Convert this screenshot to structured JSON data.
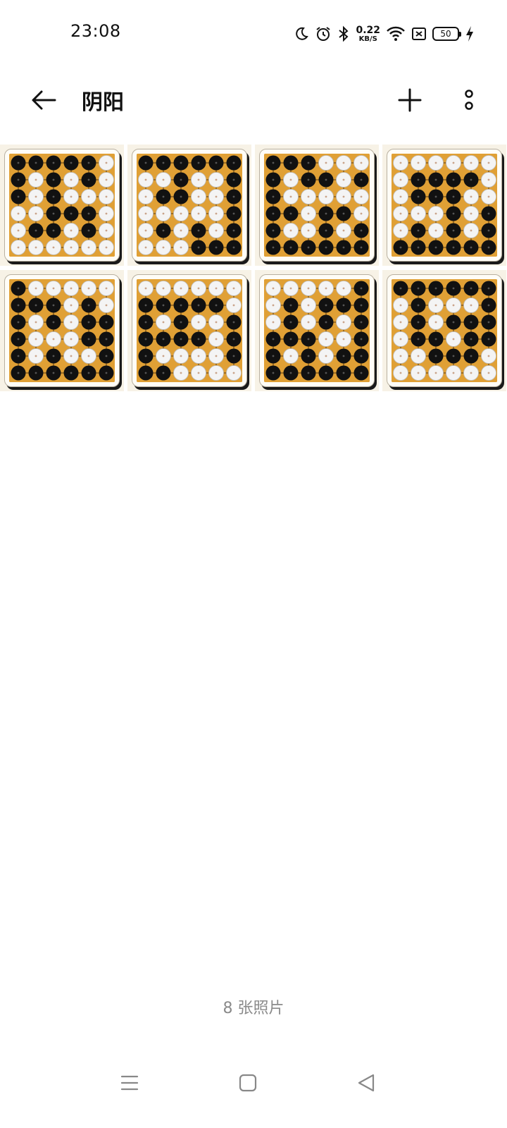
{
  "status_bar": {
    "time": "23:08",
    "net_speed_value": "0.22",
    "net_speed_unit": "KB/S",
    "battery_level": "50",
    "icons": [
      "moon-icon",
      "alarm-icon",
      "bluetooth-icon",
      "wifi-icon",
      "sim-off-icon",
      "battery-icon",
      "charging-icon"
    ]
  },
  "app_bar": {
    "title": "阴阳",
    "icons": [
      "back-arrow-icon",
      "plus-icon",
      "more-vertical-icon"
    ]
  },
  "album": {
    "photos": [
      {
        "board": [
          "BBBBBW",
          "BWBWBW",
          "BWBWWW",
          "WWBBBW",
          "WBBWBW",
          "WWWWWW"
        ]
      },
      {
        "board": [
          "BBBBBB",
          "WWBWWB",
          "WBBWWB",
          "WWWWWB",
          "WBWBWB",
          "WWWBBB"
        ]
      },
      {
        "board": [
          "BBBWWW",
          "BWBBWB",
          "BWWWWW",
          "BBWBBW",
          "BWWBWB",
          "BBBBBB"
        ]
      },
      {
        "board": [
          "WWWWWW",
          "WBBBBW",
          "WBBBWW",
          "WWWBWB",
          "WBWBWB",
          "BBBBBB"
        ]
      },
      {
        "board": [
          "BWWWWW",
          "BBBWBW",
          "BWBWBB",
          "BWWWBB",
          "BWBWWB",
          "BBBBBB"
        ]
      },
      {
        "board": [
          "WWWWWW",
          "BBBBBW",
          "BWBWWB",
          "BBBBWB",
          "BWWWWB",
          "BBWWWW"
        ]
      },
      {
        "board": [
          "WWWWWB",
          "WBWBBB",
          "WBWBWB",
          "BBBWWB",
          "BWBWBB",
          "BBBBBB"
        ]
      },
      {
        "board": [
          "BBBBBB",
          "WBWWWB",
          "WBWBBB",
          "WBBWBB",
          "WWBBBW",
          "WWWWWW"
        ]
      }
    ],
    "colors": {
      "board": "#e0a035",
      "black_stone": "#111111",
      "white_stone": "#f4f4f4"
    }
  },
  "footer": {
    "photo_count": "8 张照片"
  },
  "nav_bar": {
    "icons": [
      "menu-icon",
      "home-icon",
      "back-icon"
    ]
  }
}
